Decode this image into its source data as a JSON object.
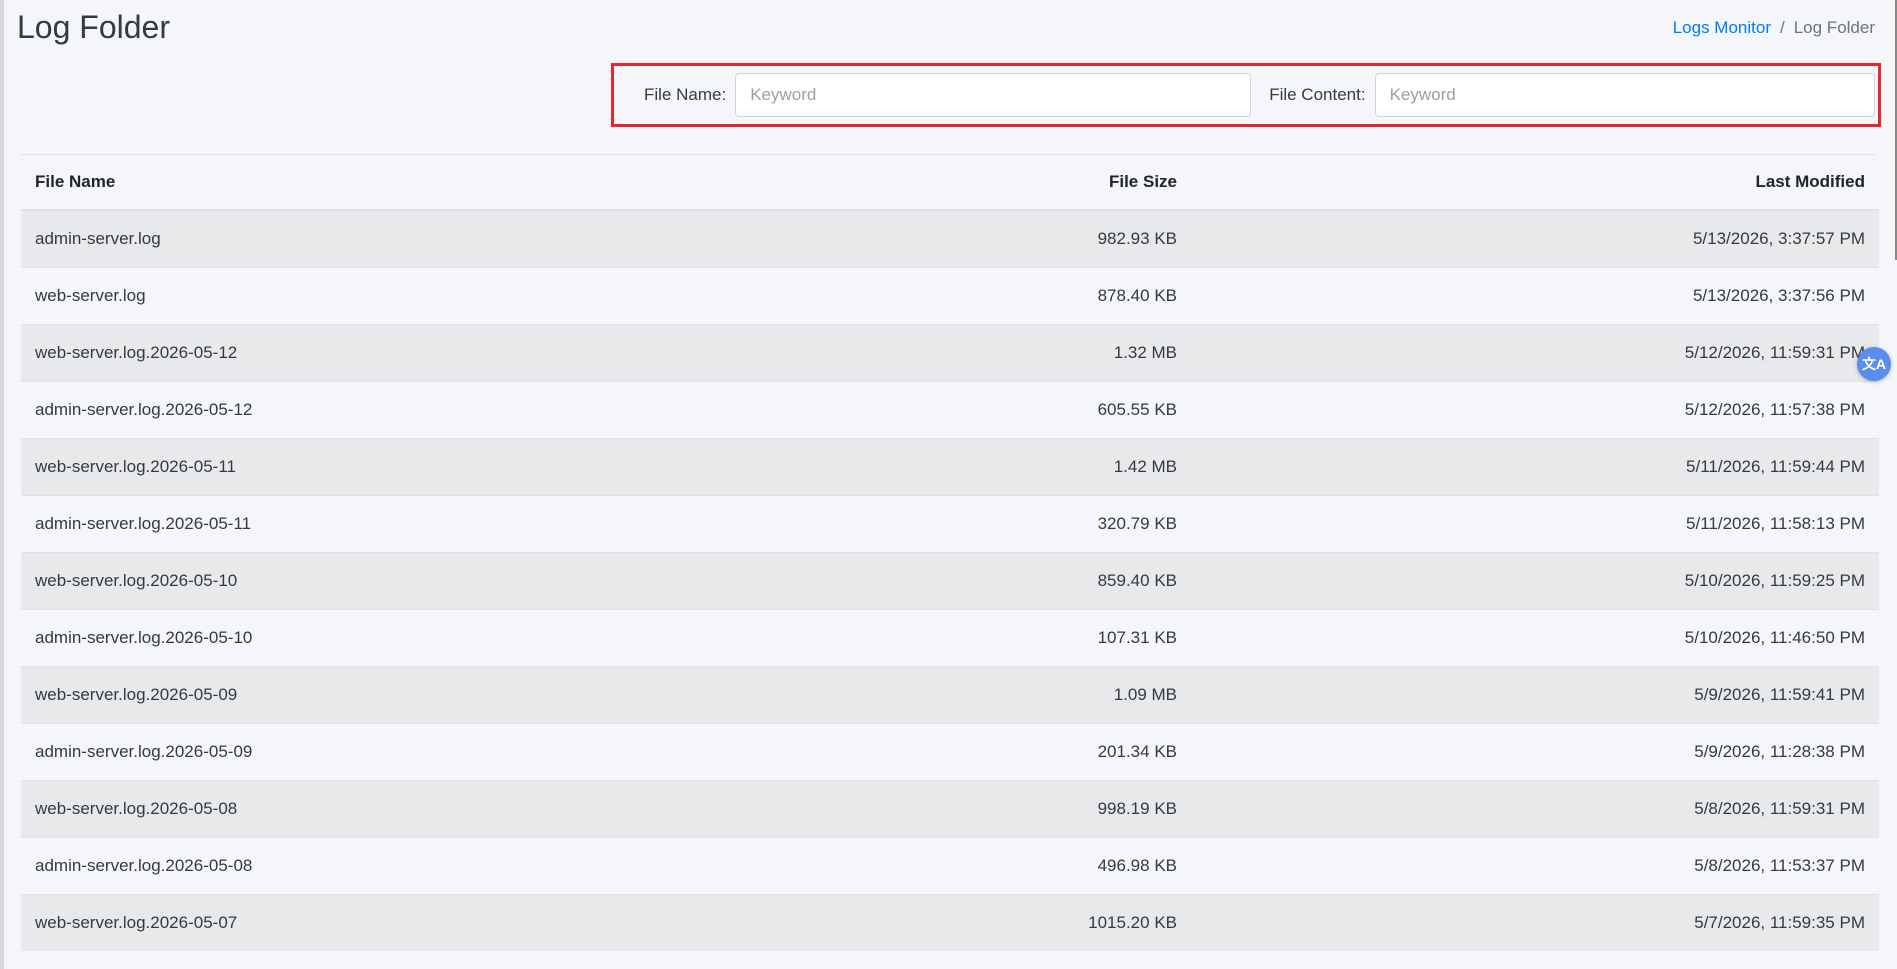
{
  "header": {
    "title": "Log Folder",
    "breadcrumb": [
      {
        "label": "Logs Monitor",
        "link": true
      },
      {
        "label": "Log Folder",
        "link": false
      }
    ],
    "separator": "/"
  },
  "filters": {
    "file_name_label": "File Name:",
    "file_name_placeholder": "Keyword",
    "file_content_label": "File Content:",
    "file_content_placeholder": "Keyword",
    "highlight_color": "#e3262f"
  },
  "table": {
    "columns": [
      "File Name",
      "File Size",
      "Last Modified"
    ],
    "rows": [
      {
        "name": "admin-server.log",
        "size": "982.93 KB",
        "modified": "5/13/2026, 3:37:57 PM"
      },
      {
        "name": "web-server.log",
        "size": "878.40 KB",
        "modified": "5/13/2026, 3:37:56 PM"
      },
      {
        "name": "web-server.log.2026-05-12",
        "size": "1.32 MB",
        "modified": "5/12/2026, 11:59:31 PM"
      },
      {
        "name": "admin-server.log.2026-05-12",
        "size": "605.55 KB",
        "modified": "5/12/2026, 11:57:38 PM"
      },
      {
        "name": "web-server.log.2026-05-11",
        "size": "1.42 MB",
        "modified": "5/11/2026, 11:59:44 PM"
      },
      {
        "name": "admin-server.log.2026-05-11",
        "size": "320.79 KB",
        "modified": "5/11/2026, 11:58:13 PM"
      },
      {
        "name": "web-server.log.2026-05-10",
        "size": "859.40 KB",
        "modified": "5/10/2026, 11:59:25 PM"
      },
      {
        "name": "admin-server.log.2026-05-10",
        "size": "107.31 KB",
        "modified": "5/10/2026, 11:46:50 PM"
      },
      {
        "name": "web-server.log.2026-05-09",
        "size": "1.09 MB",
        "modified": "5/9/2026, 11:59:41 PM"
      },
      {
        "name": "admin-server.log.2026-05-09",
        "size": "201.34 KB",
        "modified": "5/9/2026, 11:28:38 PM"
      },
      {
        "name": "web-server.log.2026-05-08",
        "size": "998.19 KB",
        "modified": "5/8/2026, 11:59:31 PM"
      },
      {
        "name": "admin-server.log.2026-05-08",
        "size": "496.98 KB",
        "modified": "5/8/2026, 11:53:37 PM"
      },
      {
        "name": "web-server.log.2026-05-07",
        "size": "1015.20 KB",
        "modified": "5/7/2026, 11:59:35 PM"
      }
    ]
  },
  "icons": {
    "translate": "translate-icon",
    "translate_glyph": "文A"
  }
}
